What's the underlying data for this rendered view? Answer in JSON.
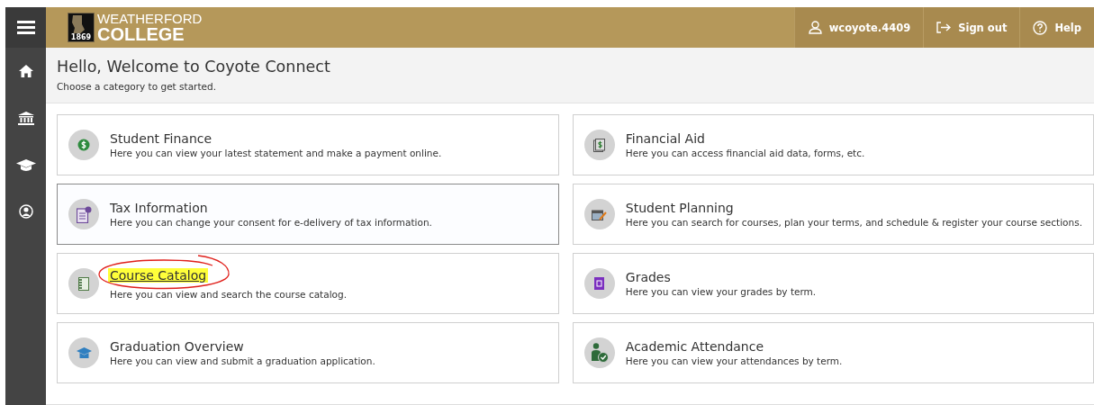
{
  "header": {
    "logo": {
      "year": "1869",
      "line1": "WEATHERFORD",
      "line2": "COLLEGE"
    },
    "actions": [
      {
        "kind": "user",
        "label": "wcoyote.4409"
      },
      {
        "kind": "signout",
        "label": "Sign out"
      },
      {
        "kind": "help",
        "label": "Help"
      }
    ]
  },
  "sidebar": {
    "items": [
      {
        "kind": "home"
      },
      {
        "kind": "institution"
      },
      {
        "kind": "academics"
      },
      {
        "kind": "profile"
      }
    ]
  },
  "welcome": {
    "title": "Hello, Welcome to Coyote Connect",
    "subtitle": "Choose a category to get started."
  },
  "categories": [
    {
      "title": "Student Finance",
      "description": "Here you can view your latest statement and make a payment online.",
      "focused": false,
      "highlighted": false
    },
    {
      "title": "Financial Aid",
      "description": "Here you can access financial aid data, forms, etc.",
      "focused": false,
      "highlighted": false
    },
    {
      "title": "Tax Information",
      "description": "Here you can change your consent for e-delivery of tax information.",
      "focused": true,
      "highlighted": false
    },
    {
      "title": "Student Planning",
      "description": "Here you can search for courses, plan your terms, and schedule & register your course sections.",
      "focused": false,
      "highlighted": false
    },
    {
      "title": "Course Catalog",
      "description": "Here you can view and search the course catalog.",
      "focused": false,
      "highlighted": true
    },
    {
      "title": "Grades",
      "description": "Here you can view your grades by term.",
      "focused": false,
      "highlighted": false
    },
    {
      "title": "Graduation Overview",
      "description": "Here you can view and submit a graduation application.",
      "focused": false,
      "highlighted": false
    },
    {
      "title": "Academic Attendance",
      "description": "Here you can view your attendances by term.",
      "focused": false,
      "highlighted": false
    }
  ]
}
